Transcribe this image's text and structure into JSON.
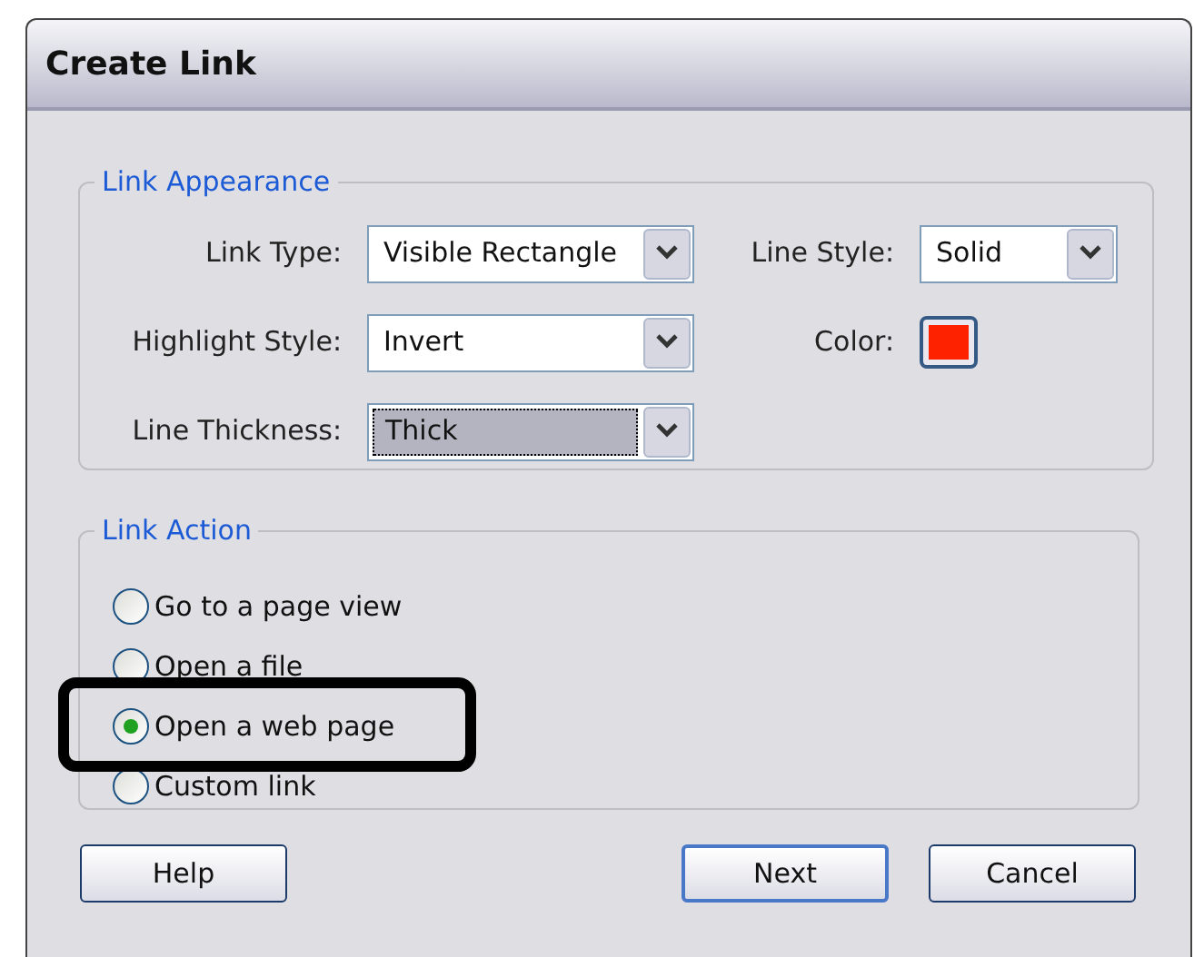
{
  "window": {
    "title": "Create Link"
  },
  "link_appearance": {
    "legend": "Link Appearance",
    "link_type": {
      "label": "Link Type:",
      "value": "Visible Rectangle",
      "focused": false
    },
    "line_style": {
      "label": "Line Style:",
      "value": "Solid",
      "focused": false
    },
    "highlight_style": {
      "label": "Highlight Style:",
      "value": "Invert",
      "focused": false
    },
    "color": {
      "label": "Color:",
      "color": "#ff2200"
    },
    "line_thickness": {
      "label": "Line Thickness:",
      "value": "Thick",
      "focused": true
    }
  },
  "link_action": {
    "legend": "Link Action",
    "options": [
      {
        "label": "Go to a page view",
        "selected": false,
        "highlighted": false
      },
      {
        "label": "Open a file",
        "selected": false,
        "highlighted": false
      },
      {
        "label": "Open a web page",
        "selected": true,
        "highlighted": true
      },
      {
        "label": "Custom link",
        "selected": false,
        "highlighted": false
      }
    ]
  },
  "buttons": [
    {
      "label": "Help",
      "default": false
    },
    {
      "label": "Next",
      "default": true
    },
    {
      "label": "Cancel",
      "default": false
    }
  ]
}
